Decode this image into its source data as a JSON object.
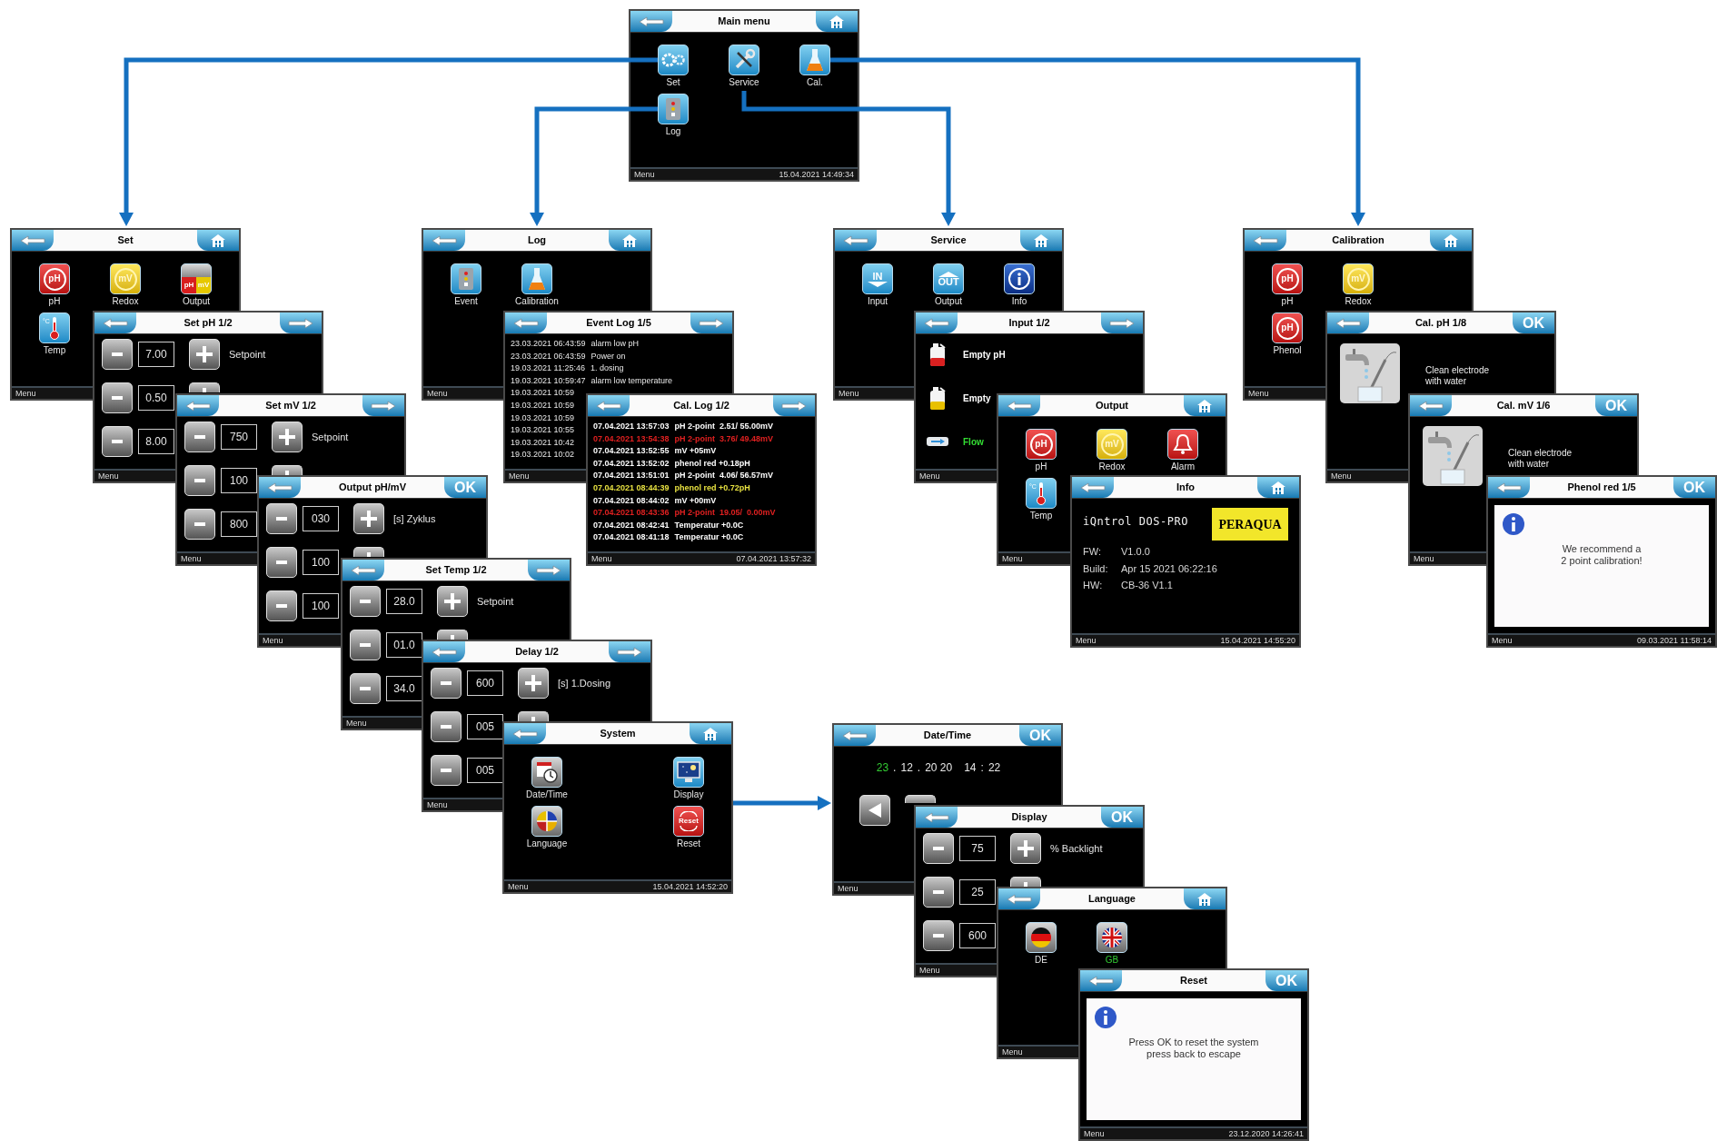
{
  "screens": [
    {
      "title": "Main menu",
      "right": {
        "kind": "home"
      },
      "body": {
        "kind": "icons",
        "items": [
          {
            "kind": "gears",
            "label": "Set"
          },
          {
            "kind": "tools",
            "label": "Service"
          },
          {
            "kind": "flask",
            "label": "Cal."
          },
          {
            "kind": "logbook",
            "label": "Log"
          }
        ]
      },
      "footer": {
        "menu": "Menu",
        "time": "15.04.2021 14:49:34"
      }
    },
    {
      "title": "Set",
      "right": {
        "kind": "home"
      },
      "body": {
        "kind": "icons",
        "items": [
          {
            "kind": "ph",
            "icon_text": [
              "pH"
            ],
            "label": "pH"
          },
          {
            "kind": "mv",
            "icon_text": [
              "mV"
            ],
            "label": "Redox"
          },
          {
            "kind": "output",
            "icon_text": [
              "pH",
              "mV"
            ],
            "label": "Output"
          },
          {
            "kind": "temp",
            "icon_text": [
              "°C"
            ],
            "label": "Temp"
          }
        ]
      },
      "footer": {
        "menu": "Menu"
      }
    },
    {
      "title": "Set pH 1/2",
      "right": {
        "kind": "next"
      },
      "body": {
        "kind": "setpoint",
        "rows": [
          {
            "value": "7.00",
            "plus": true,
            "label": "Setpoint"
          },
          {
            "value": "0.50",
            "plus": true
          },
          {
            "value": "8.00",
            "plus": false
          }
        ]
      },
      "footer": {
        "menu": "Menu"
      }
    },
    {
      "title": "Set mV 1/2",
      "right": {
        "kind": "next"
      },
      "body": {
        "kind": "setpoint",
        "rows": [
          {
            "value": "750",
            "plus": true,
            "label": "Setpoint"
          },
          {
            "value": "100",
            "plus": true
          },
          {
            "value": "800",
            "plus": false
          }
        ]
      },
      "footer": {
        "menu": "Menu"
      }
    },
    {
      "title": "Output pH/mV",
      "right": {
        "kind": "ok",
        "label": "OK"
      },
      "body": {
        "kind": "setpoint",
        "rows": [
          {
            "value": "030",
            "plus": true,
            "label": "[s] Zyklus"
          },
          {
            "value": "100",
            "plus": true
          },
          {
            "value": "100",
            "plus": false
          }
        ]
      },
      "footer": {
        "menu": "Menu"
      }
    },
    {
      "title": "Set Temp 1/2",
      "right": {
        "kind": "next"
      },
      "body": {
        "kind": "setpoint",
        "rows": [
          {
            "value": "28.0",
            "plus": true,
            "label": "Setpoint"
          },
          {
            "value": "01.0",
            "plus": true
          },
          {
            "value": "34.0",
            "plus": false
          }
        ]
      },
      "footer": {
        "menu": "Menu"
      }
    },
    {
      "title": "Delay 1/2",
      "right": {
        "kind": "next"
      },
      "body": {
        "kind": "setpoint",
        "rows": [
          {
            "value": "600",
            "plus": true,
            "label": "[s] 1.Dosing"
          },
          {
            "value": "005",
            "plus": true
          },
          {
            "value": "005",
            "plus": false
          }
        ]
      },
      "footer": {
        "menu": "Menu"
      }
    },
    {
      "title": "System",
      "right": {
        "kind": "home"
      },
      "body": {
        "kind": "icons-wide",
        "items": [
          {
            "kind": "datetime",
            "label": "Date/Time"
          },
          {
            "kind": "language",
            "label": "Language"
          },
          {
            "kind": "display",
            "label": "Display"
          },
          {
            "kind": "reset",
            "icon_text": [
              "Reset"
            ],
            "label": "Reset"
          }
        ]
      },
      "footer": {
        "menu": "Menu",
        "time": "15.04.2021 14:52:20"
      }
    },
    {
      "title": "Log",
      "right": {
        "kind": "home"
      },
      "body": {
        "kind": "icons",
        "items": [
          {
            "kind": "logbook",
            "label": "Event"
          },
          {
            "kind": "flask",
            "label": "Calibration"
          }
        ]
      },
      "footer": {
        "menu": "Menu"
      }
    },
    {
      "title": "Event Log 1/5",
      "right": {
        "kind": "next"
      },
      "body": {
        "kind": "log",
        "lines": [
          {
            "time": "23.03.2021 06:43:59",
            "entry": "alarm low pH"
          },
          {
            "time": "23.03.2021 06:43:59",
            "entry": "Power on"
          },
          {
            "time": "19.03.2021 11:25:46",
            "entry": "1. dosing"
          },
          {
            "time": "19.03.2021 10:59:47",
            "entry": "alarm low temperature"
          },
          {
            "time": "19.03.2021 10:59"
          },
          {
            "time": "19.03.2021 10:59"
          },
          {
            "time": "19.03.2021 10:59"
          },
          {
            "time": "19.03.2021 10:55"
          },
          {
            "time": "19.03.2021 10:42"
          },
          {
            "time": "19.03.2021 10:02"
          }
        ]
      },
      "footer": {
        "menu": "Menu"
      }
    },
    {
      "title": "Cal. Log 1/2",
      "right": {
        "kind": "next"
      },
      "body": {
        "kind": "log",
        "lines": [
          {
            "time": "07.04.2021 13:57:03",
            "entry": "pH 2-point  2.51/ 55.00mV",
            "color": "#ffffff"
          },
          {
            "time": "07.04.2021 13:54:38",
            "entry": "pH 2-point  3.76/ 49.48mV",
            "color": "#e02020"
          },
          {
            "time": "07.04.2021 13:52:55",
            "entry": "mV +05mV",
            "color": "#ffffff"
          },
          {
            "time": "07.04.2021 13:52:02",
            "entry": "phenol red +0.18pH",
            "color": "#ffffff"
          },
          {
            "time": "07.04.2021 13:51:01",
            "entry": "pH 2-point  4.06/ 56.57mV",
            "color": "#ffffff"
          },
          {
            "time": "07.04.2021 08:44:39",
            "entry": "phenol red +0.72pH",
            "color": "#e6e040"
          },
          {
            "time": "07.04.2021 08:44:02",
            "entry": "mV +00mV",
            "color": "#ffffff"
          },
          {
            "time": "07.04.2021 08:43:36",
            "entry": "pH 2-point  19.05/  0.00mV",
            "color": "#e02020"
          },
          {
            "time": "07.04.2021 08:42:41",
            "entry": "Temperatur +0.0C",
            "color": "#ffffff"
          },
          {
            "time": "07.04.2021 08:41:18",
            "entry": "Temperatur +0.0C",
            "color": "#ffffff"
          }
        ]
      },
      "footer": {
        "menu": "Menu",
        "time": "07.04.2021 13:57:32"
      }
    },
    {
      "title": "Service",
      "right": {
        "kind": "home"
      },
      "body": {
        "kind": "icons",
        "items": [
          {
            "kind": "in",
            "icon_text": [
              "IN"
            ],
            "label": "Input"
          },
          {
            "kind": "out",
            "icon_text": [
              "OUT"
            ],
            "label": "Output"
          },
          {
            "kind": "info",
            "label": "Info"
          }
        ]
      },
      "footer": {
        "menu": "Menu"
      }
    },
    {
      "title": "Input 1/2",
      "right": {
        "kind": "next"
      },
      "body": {
        "kind": "inputs",
        "rows": [
          {
            "kind": "can",
            "color": "#d92020",
            "label": "Empty pH",
            "highlight": false
          },
          {
            "kind": "can",
            "color": "#e8c000",
            "label": "Empty",
            "highlight": false
          },
          {
            "kind": "flow",
            "label": "Flow",
            "highlight": true
          }
        ]
      },
      "footer": {
        "menu": "Menu"
      }
    },
    {
      "title": "Output",
      "right": {
        "kind": "home"
      },
      "body": {
        "kind": "icons",
        "items": [
          {
            "kind": "ph",
            "icon_text": [
              "pH"
            ],
            "label": "pH"
          },
          {
            "kind": "mv",
            "icon_text": [
              "mV"
            ],
            "label": "Redox"
          },
          {
            "kind": "alarm",
            "label": "Alarm"
          },
          {
            "kind": "temp",
            "icon_text": [
              "°C"
            ],
            "label": "Temp"
          }
        ]
      },
      "footer": {
        "menu": "Menu"
      }
    },
    {
      "title": "Info",
      "right": {
        "kind": "home"
      },
      "body": {
        "kind": "info",
        "product": "iQntrol DOS-PRO",
        "logo": "PERAQUA",
        "fields": [
          {
            "key": "FW:",
            "value": "V1.0.0"
          },
          {
            "key": "Build:",
            "value": "Apr 15 2021 06:22:16"
          },
          {
            "key": "HW:",
            "value": "CB-36 V1.1"
          }
        ]
      },
      "footer": {
        "menu": "Menu",
        "time": "15.04.2021 14:55:20"
      }
    },
    {
      "title": "Calibration",
      "right": {
        "kind": "home"
      },
      "body": {
        "kind": "icons-two",
        "items": [
          {
            "kind": "ph",
            "icon_text": [
              "pH"
            ],
            "label": "pH"
          },
          {
            "kind": "mv",
            "icon_text": [
              "mV"
            ],
            "label": "Redox"
          },
          {
            "kind": "ph",
            "icon_text": [
              "pH"
            ],
            "label": "Phenol"
          }
        ]
      },
      "footer": {
        "menu": "Menu"
      }
    },
    {
      "title": "Cal. pH 1/8",
      "right": {
        "kind": "ok",
        "label": "OK"
      },
      "body": {
        "kind": "instruction",
        "text": "Clean electrode\nwith water"
      },
      "footer": {
        "menu": "Menu"
      }
    },
    {
      "title": "Cal. mV 1/6",
      "right": {
        "kind": "ok",
        "label": "OK"
      },
      "body": {
        "kind": "instruction",
        "text": "Clean electrode\nwith water"
      },
      "footer": {
        "menu": "Menu"
      }
    },
    {
      "title": "Phenol red 1/5",
      "right": {
        "kind": "ok",
        "label": "OK"
      },
      "body": {
        "kind": "message",
        "text": "We recommend a\n2 point calibration!"
      },
      "footer": {
        "menu": "Menu",
        "time": "09.03.2021 11:58:14"
      }
    },
    {
      "title": "Date/Time",
      "right": {
        "kind": "ok",
        "label": "OK"
      },
      "body": {
        "kind": "datetime",
        "parts": [
          {
            "kind": "field",
            "text": "23",
            "selected": true
          },
          {
            "kind": "separator",
            "text": "."
          },
          {
            "kind": "field",
            "text": "12",
            "selected": false
          },
          {
            "kind": "separator",
            "text": "."
          },
          {
            "kind": "field",
            "text": "20 20",
            "selected": false
          },
          {
            "kind": "field",
            "text": "14",
            "selected": false
          },
          {
            "kind": "separator",
            "text": ":"
          },
          {
            "kind": "field",
            "text": "22",
            "selected": false
          }
        ],
        "keys": [
          {
            "kind": "left"
          },
          {
            "kind": "plain"
          }
        ]
      },
      "footer": {
        "menu": "Menu"
      }
    },
    {
      "title": "Display",
      "right": {
        "kind": "ok",
        "label": "OK"
      },
      "body": {
        "kind": "setpoint",
        "rows": [
          {
            "value": "75",
            "plus": true,
            "label": "% Backlight"
          },
          {
            "value": "25",
            "plus": true
          },
          {
            "value": "600",
            "plus": false
          }
        ]
      },
      "footer": {
        "menu": "Menu"
      }
    },
    {
      "title": "Language",
      "right": {
        "kind": "home"
      },
      "body": {
        "kind": "icons",
        "items": [
          {
            "kind": "de",
            "label": "DE",
            "selected": false
          },
          {
            "kind": "gb",
            "label": "GB",
            "selected": true
          }
        ]
      },
      "footer": {
        "menu": "Menu"
      }
    },
    {
      "title": "Reset",
      "right": {
        "kind": "ok",
        "label": "OK"
      },
      "body": {
        "kind": "message",
        "text": "Press OK to reset the system\npress back to escape"
      },
      "footer": {
        "menu": "Menu",
        "time": "23.12.2020 14:26:41"
      }
    }
  ]
}
